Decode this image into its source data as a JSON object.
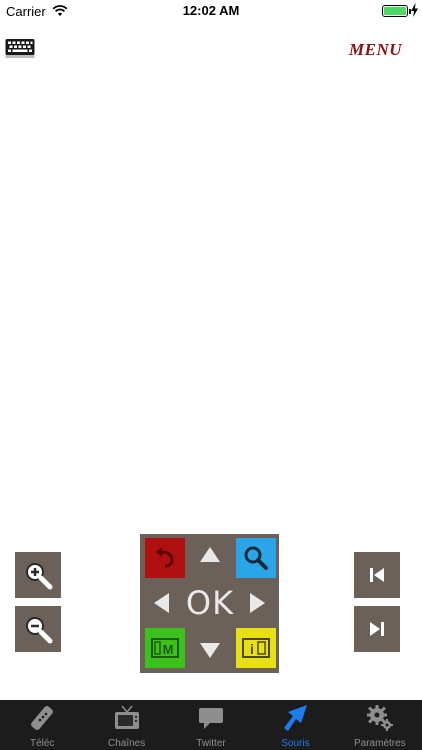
{
  "statusbar": {
    "carrier": "Carrier",
    "time": "12:02 AM",
    "battery_level": 1.0
  },
  "topbar": {
    "keyboard_icon": "keyboard-icon",
    "menu_label": "MENU"
  },
  "remote": {
    "ok_label": "OK",
    "back_icon": "back-arrow-icon",
    "search_icon": "search-icon",
    "menu_key_icon": "menu-m-icon",
    "info_key_icon": "info-i-icon"
  },
  "side": {
    "zoom_in_icon": "zoom-in-icon",
    "zoom_out_icon": "zoom-out-icon",
    "prev_icon": "skip-previous-icon",
    "next_icon": "skip-next-icon"
  },
  "tabs": [
    {
      "label": "Téléc",
      "icon": "remote-icon",
      "active": false
    },
    {
      "label": "Chaînes",
      "icon": "tv-icon",
      "active": false
    },
    {
      "label": "Twitter",
      "icon": "speech-bubble-icon",
      "active": false
    },
    {
      "label": "Souris",
      "icon": "mouse-pointer-icon",
      "active": true
    },
    {
      "label": "Paramètres",
      "icon": "gears-icon",
      "active": false
    }
  ],
  "colors": {
    "accent": "#1c7cf0",
    "menu_text": "#8b1010",
    "button_bg": "#6b6159",
    "key_red": "#b01010",
    "key_blue": "#2aa6e8",
    "key_green": "#3ac21a",
    "key_yellow": "#e8e010",
    "tabbar_bg": "#1c1c1c"
  }
}
